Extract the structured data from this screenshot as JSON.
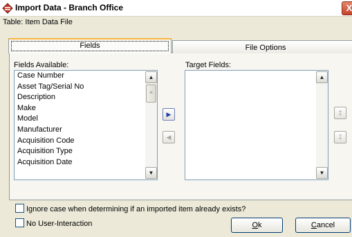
{
  "window": {
    "title": "Import Data - Branch Office",
    "close_symbol": "X"
  },
  "table_label": "Table: Item Data File",
  "tabs": [
    {
      "label": "Fields",
      "selected": true
    },
    {
      "label": "File Options",
      "selected": false
    }
  ],
  "fields_available": {
    "label": "Fields Available:",
    "items": [
      "Case Number",
      "Asset Tag/Serial No",
      "Description",
      "Make",
      "Model",
      "Manufacturer",
      "Acquisition Code",
      "Acquisition Type",
      "Acquisition Date"
    ]
  },
  "target_fields": {
    "label": "Target Fields:",
    "items": []
  },
  "move_buttons": {
    "add_icon": "arrow-right-icon",
    "remove_icon": "arrow-left-icon",
    "move_up_icon": "move-up-icon",
    "move_down_icon": "move-down-icon"
  },
  "options": {
    "ignore_case_label": "Ignore case when determining if an imported item already exists?",
    "ignore_case_checked": false,
    "no_interaction_label": "No User-Interaction",
    "no_interaction_checked": false
  },
  "buttons": {
    "ok_underlined": "O",
    "ok_rest": "k",
    "cancel_underlined": "C",
    "cancel_rest": "ancel"
  },
  "colors": {
    "dialog_bg": "#ece9d8",
    "tab_highlight": "#f8b43c",
    "list_border": "#7f9db9",
    "close_button": "#c4452a",
    "active_arrow": "#1f3fa8"
  }
}
